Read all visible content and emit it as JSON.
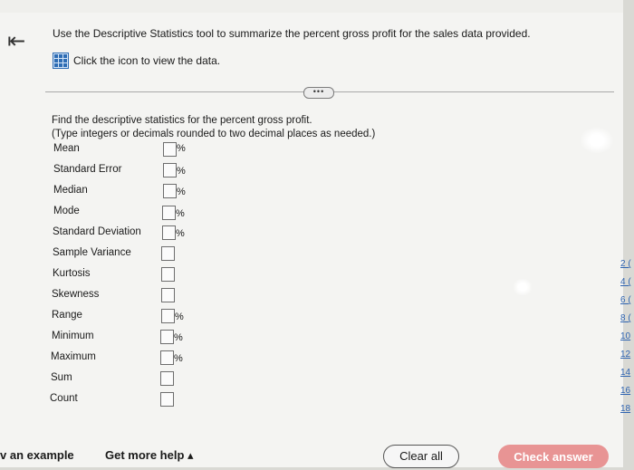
{
  "header": {
    "back_icon": "back-arrow-icon",
    "intro_text": "Use the Descriptive Statistics tool to summarize the percent gross profit for the sales data provided.",
    "data_link_text": "Click the icon to view the data.",
    "data_icon": "data-table-icon",
    "more_label": "•••"
  },
  "question": {
    "line1": "Find the descriptive statistics for the percent gross profit.",
    "line2": "(Type integers or decimals rounded to two decimal places as needed.)"
  },
  "stats": [
    {
      "label": "Mean",
      "unit": "%"
    },
    {
      "label": "Standard Error",
      "unit": "%"
    },
    {
      "label": "Median",
      "unit": "%"
    },
    {
      "label": "Mode",
      "unit": "%"
    },
    {
      "label": "Standard Deviation",
      "unit": "%"
    },
    {
      "label": "Sample Variance",
      "unit": ""
    },
    {
      "label": "Kurtosis",
      "unit": ""
    },
    {
      "label": "Skewness",
      "unit": ""
    },
    {
      "label": "Range",
      "unit": "%"
    },
    {
      "label": "Minimum",
      "unit": "%"
    },
    {
      "label": "Maximum",
      "unit": "%"
    },
    {
      "label": "Sum",
      "unit": ""
    },
    {
      "label": "Count",
      "unit": ""
    }
  ],
  "side_links": [
    "2 (",
    "4 (",
    "6 (",
    "8 (",
    "10",
    "12",
    "14",
    "16",
    "18"
  ],
  "footer": {
    "view_example": "v an example",
    "get_more_help": "Get more help ▴",
    "clear_all": "Clear all",
    "check_answer": "Check answer"
  }
}
